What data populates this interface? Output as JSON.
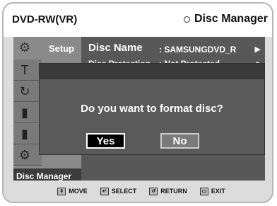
{
  "header": {
    "left_title": "DVD-RW(VR)",
    "right_title": "Disc Manager",
    "right_icon": "disc-icon"
  },
  "sidebar": {
    "setup_label": "Setup",
    "items": [
      {
        "icon": "title-list-icon",
        "glyph": "T"
      },
      {
        "icon": "playlist-icon",
        "glyph": "↻"
      },
      {
        "icon": "edit-icon",
        "glyph": "▮"
      },
      {
        "icon": "copy-icon",
        "glyph": "▮"
      },
      {
        "icon": "disc-manager-icon",
        "glyph": "⚙"
      }
    ],
    "disc_manager_label": "Disc Manager"
  },
  "menu": {
    "disc_name_label": "Disc Name",
    "disc_name_value": ": SAMSUNGDVD_R",
    "disc_protection_label": "Disc Protection",
    "disc_protection_value": ": Not Protected"
  },
  "dialog": {
    "message": "Do you want to format disc?",
    "yes_label": "Yes",
    "no_label": "No"
  },
  "footer": {
    "move": "MOVE",
    "select": "SELECT",
    "return": "RETURN",
    "exit": "EXIT"
  }
}
